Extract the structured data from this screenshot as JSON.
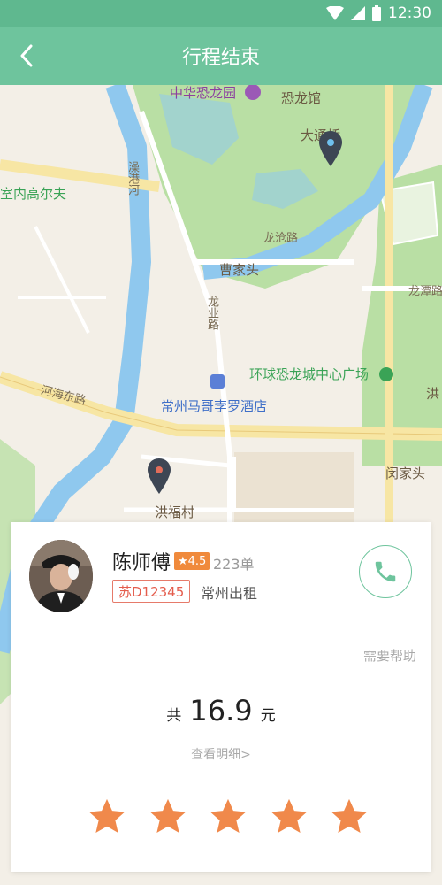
{
  "status_bar": {
    "time": "12:30"
  },
  "header": {
    "title": "行程结束"
  },
  "map": {
    "labels": {
      "park": "中华恐龙园",
      "dino_hall": "恐龙馆",
      "bridge": "大通桥",
      "golf": "室内高尔夫",
      "river": "澡港河",
      "longcang_road": "龙沧路",
      "caojiatou": "曹家头",
      "longtan_road": "龙潭路",
      "longye_road": "龙业路",
      "plaza": "环球恐龙城中心广场",
      "hong": "洪",
      "hehai_road": "河海东路",
      "hotel": "常州马哥孛罗酒店",
      "minjiatou": "闵家头",
      "hongfucun": "洪福村"
    }
  },
  "driver": {
    "name": "陈师傅",
    "rating": "★4.5",
    "orders": "223单",
    "plate": "苏D12345",
    "company": "常州出租"
  },
  "card": {
    "help_label": "需要帮助",
    "total_prefix": "共",
    "total_amount": "16.9",
    "total_unit": "元",
    "detail_link": "查看明细>"
  },
  "rating_stars": {
    "count": 5,
    "color": "#f0894b"
  },
  "colors": {
    "accent": "#6ec49d",
    "status_bar": "#5fb88f",
    "badge": "#f08a3c",
    "plate": "#e45c4c"
  }
}
